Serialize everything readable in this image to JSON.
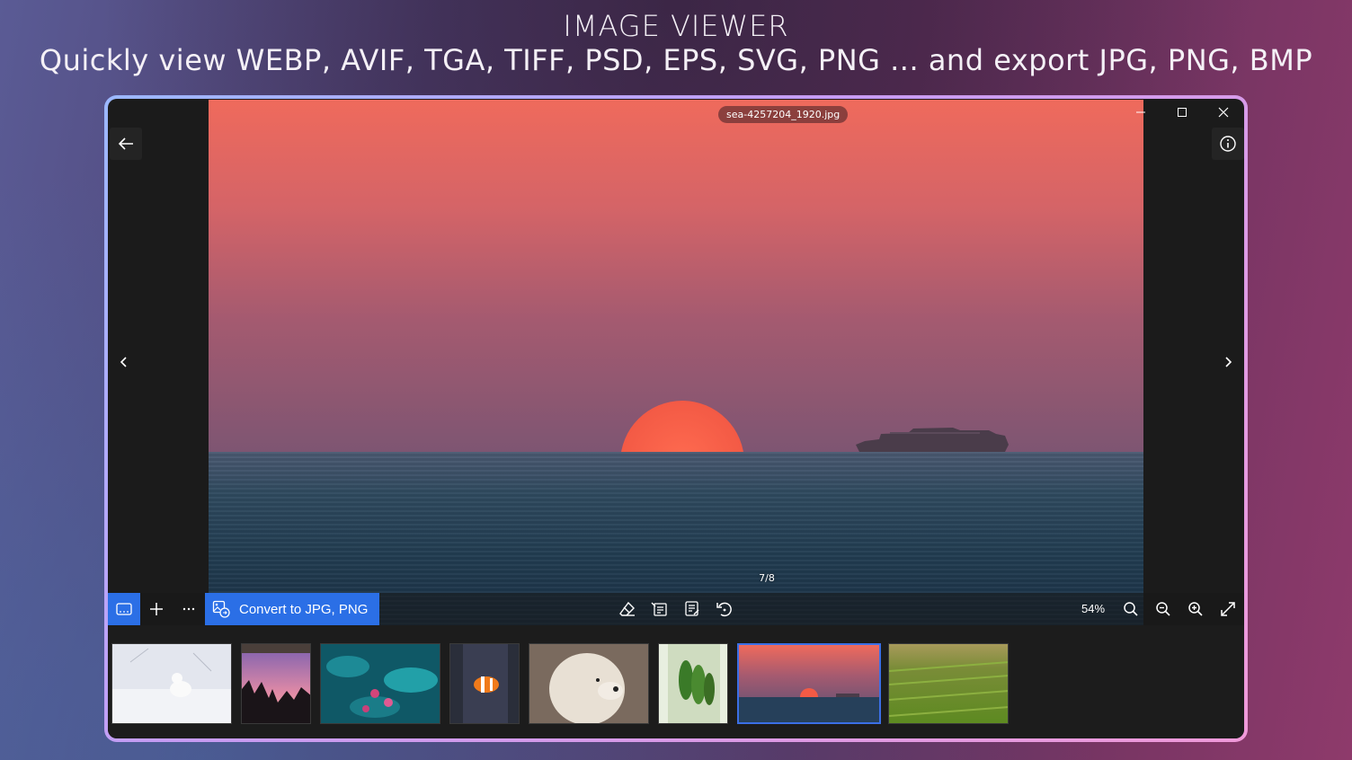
{
  "promo": {
    "title": "IMAGE VIEWER",
    "subtitle": "Quickly view WEBP, AVIF, TGA, TIFF, PSD, EPS, SVG, PNG ... and export JPG, PNG, BMP"
  },
  "viewer": {
    "filename": "sea-4257204_1920.jpg",
    "counter": "7/8",
    "zoom": "54%"
  },
  "toolbar": {
    "convert_label": "Convert to JPG, PNG"
  },
  "filmstrip": {
    "count": 8,
    "active_index": 7,
    "thumbnails": [
      "snow cat",
      "tree silhouette sunset",
      "lotus flowers",
      "clownfish",
      "white dog",
      "bananas",
      "sea sunset",
      "green field"
    ]
  },
  "colors": {
    "accent": "#2b6fe6",
    "window_bg": "#1b1b1b"
  },
  "icons": [
    "arrow-left-icon",
    "info-icon",
    "chevron-left-icon",
    "chevron-right-icon",
    "minimize-icon",
    "maximize-icon",
    "close-icon",
    "filmstrip-icon",
    "plus-icon",
    "more-icon",
    "image-convert-icon",
    "eraser-icon",
    "document-edit-icon",
    "notes-icon",
    "rotate-icon",
    "search-icon",
    "zoom-out-icon",
    "zoom-in-icon",
    "fullscreen-icon"
  ]
}
